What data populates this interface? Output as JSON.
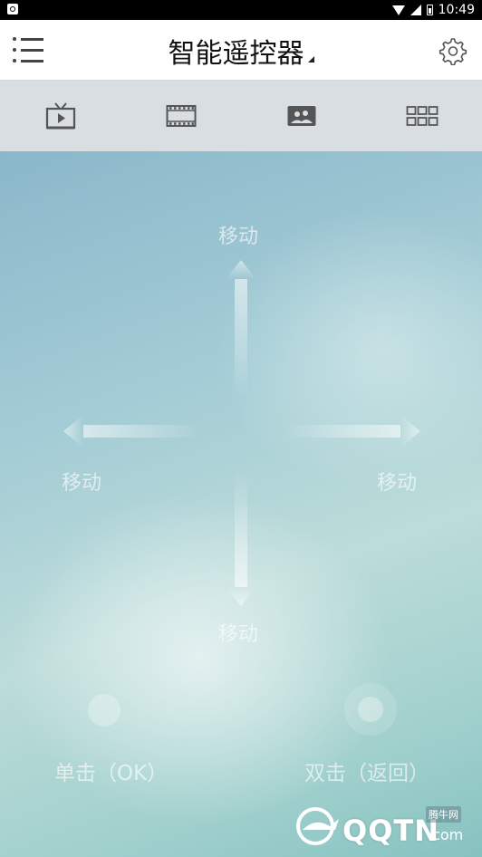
{
  "status": {
    "time": "10:49"
  },
  "header": {
    "title": "智能遥控器"
  },
  "tabs": [
    {
      "id": "tv",
      "icon": "tv-icon"
    },
    {
      "id": "video",
      "icon": "film-icon"
    },
    {
      "id": "photo",
      "icon": "image-icon"
    },
    {
      "id": "apps",
      "icon": "grid-icon"
    }
  ],
  "remote": {
    "up_label": "移动",
    "left_label": "移动",
    "right_label": "移动",
    "down_label": "移动",
    "single_tap_label": "单击（OK）",
    "double_tap_label": "双击（返回）"
  },
  "watermark": {
    "text": "QQTN",
    "domain": ".com",
    "badge": "腾牛网"
  }
}
